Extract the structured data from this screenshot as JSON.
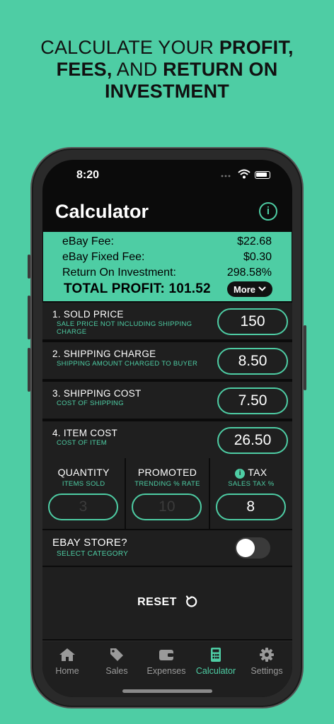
{
  "headline": {
    "line1_normal": "CALCULATE YOUR ",
    "line1_bold": "PROFIT,",
    "line2_bold1": "FEES,",
    "line2_normal": " AND ",
    "line2_bold2": "RETURN ON",
    "line3_bold": "INVESTMENT"
  },
  "status": {
    "time": "8:20"
  },
  "header": {
    "title": "Calculator",
    "info_icon": "info-circle-icon"
  },
  "summary": {
    "ebay_fee_label": "eBay Fee:",
    "ebay_fee_value": "$22.68",
    "fixed_fee_label": "eBay Fixed Fee:",
    "fixed_fee_value": "$0.30",
    "roi_label": "Return On Investment:",
    "roi_value": "298.58%",
    "total_profit": "TOTAL PROFIT: 101.52",
    "more_label": "More"
  },
  "fields": [
    {
      "label": "1. SOLD PRICE",
      "sub": "SALE PRICE NOT INCLUDING SHIPPING CHARGE",
      "value": "150"
    },
    {
      "label": "2. SHIPPING CHARGE",
      "sub": "SHIPPING AMOUNT CHARGED TO BUYER",
      "value": "8.50"
    },
    {
      "label": "3. SHIPPING COST",
      "sub": "COST OF SHIPPING",
      "value": "7.50"
    },
    {
      "label": "4. ITEM COST",
      "sub": "COST OF ITEM",
      "value": "26.50"
    }
  ],
  "small_fields": {
    "quantity": {
      "label": "QUANTITY",
      "sub": "ITEMS SOLD",
      "placeholder": "3"
    },
    "promoted": {
      "label": "PROMOTED",
      "sub": "TRENDING % RATE",
      "placeholder": "10"
    },
    "tax": {
      "label": "TAX",
      "sub": "SALES TAX %",
      "value": "8"
    }
  },
  "store": {
    "label": "EBAY STORE?",
    "sub": "SELECT CATEGORY",
    "enabled": false
  },
  "reset_label": "RESET",
  "tabs": [
    {
      "label": "Home",
      "icon": "home-icon"
    },
    {
      "label": "Sales",
      "icon": "tag-icon"
    },
    {
      "label": "Expenses",
      "icon": "wallet-icon"
    },
    {
      "label": "Calculator",
      "icon": "calculator-icon",
      "active": true
    },
    {
      "label": "Settings",
      "icon": "gear-icon"
    }
  ],
  "colors": {
    "accent": "#4ecda4",
    "background": "#0b0b0b",
    "panel": "#1f1f1f"
  }
}
